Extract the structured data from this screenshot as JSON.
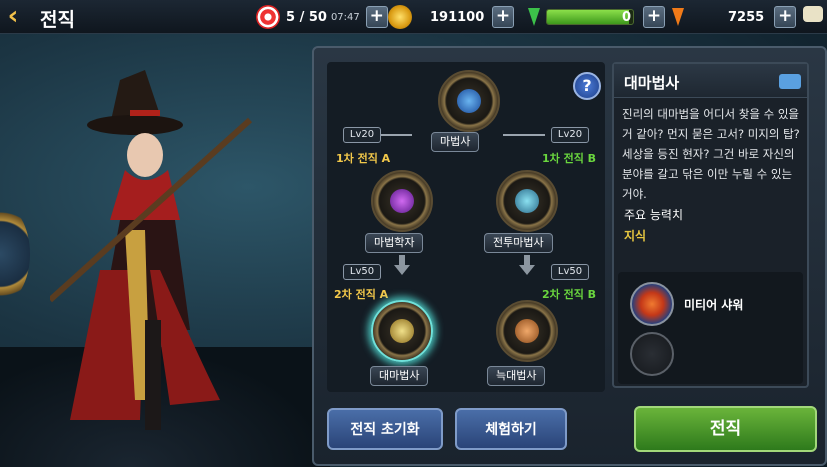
{
  "topbar": {
    "title": "전직",
    "stamina": "5 / 50",
    "stamina_timer": "07:47",
    "gold": "191100",
    "energy_value": "0",
    "energy_fill": 0.95,
    "carrots": "7255",
    "plus": "+"
  },
  "tree": {
    "help": "?",
    "root": {
      "name": "마법사"
    },
    "branch_a": {
      "level": "Lv20",
      "tier": "1차 전직 A",
      "name": "마법학자"
    },
    "branch_b": {
      "level": "Lv20",
      "tier": "1차 전직 B",
      "name": "전투마법사"
    },
    "adv_a": {
      "level": "Lv50",
      "tier": "2차 전직 A",
      "name": "대마법사"
    },
    "adv_b": {
      "level": "Lv50",
      "tier": "2차 전직 B",
      "name": "늑대법사"
    }
  },
  "info": {
    "title": "대마법사",
    "description": "진리의 대마법을 어디서 찾을 수 있을 거 같아? 먼지 묻은 고서? 미지의 탑? 세상을 등진 현자? 그건 바로 자신의 분야를 갈고 닦은 이만 누릴 수 있는 거야.",
    "stat_label": "주요 능력치",
    "stat_value": "지식",
    "skill_name": "미티어 샤워"
  },
  "buttons": {
    "reset": "전직 초기화",
    "trial": "체험하기",
    "advance": "전직"
  },
  "colors": {
    "tier_a": "#f2c84a",
    "tier_b": "#6ad63e",
    "selected_glow": "#4ac6c0"
  }
}
